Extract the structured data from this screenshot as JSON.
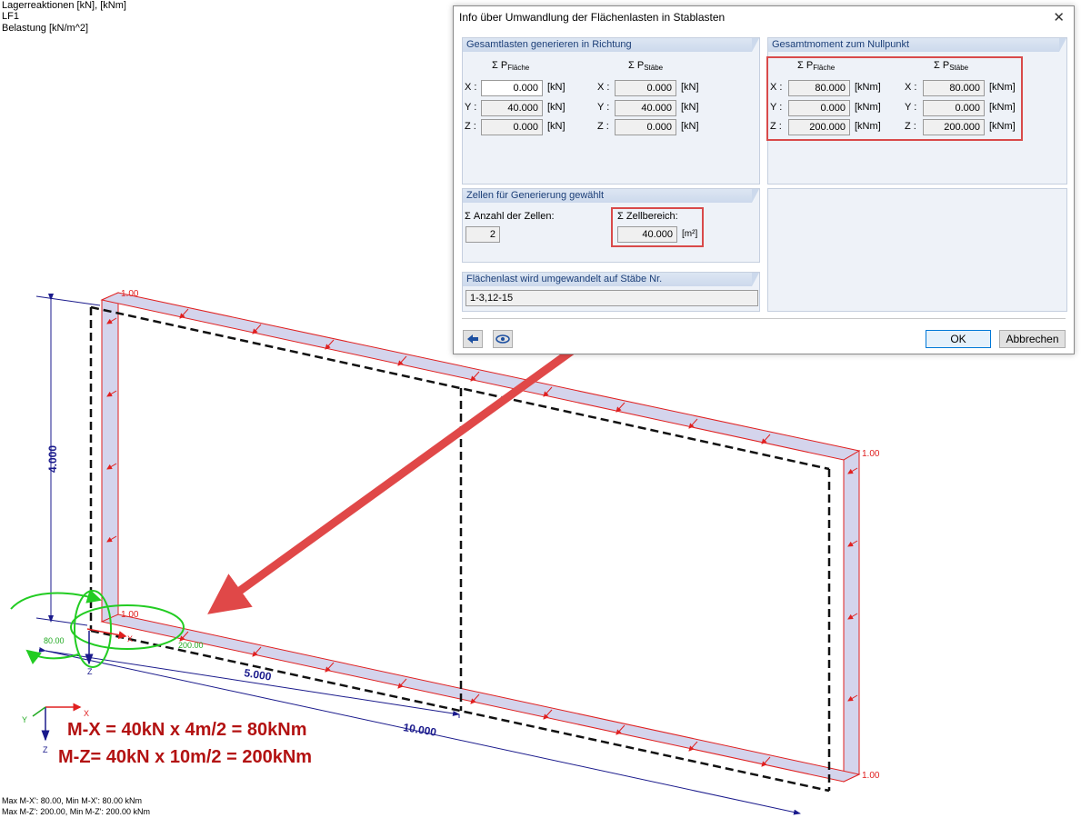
{
  "info": {
    "line1": "Lagerreaktionen [kN], [kNm]",
    "line2": "LF1",
    "line3": "Belastung [kN/m^2]"
  },
  "footer": {
    "line1": "Max M-X': 80.00, Min M-X': 80.00 kNm",
    "line2": "Max M-Z': 200.00, Min M-Z': 200.00 kNm"
  },
  "annotations": {
    "formula1": "M-X = 40kN x 4m/2 = 80kNm",
    "formula2": "M-Z= 40kN x 10m/2 = 200kNm"
  },
  "model": {
    "dim_height": "4.000",
    "dim_half": "5.000",
    "dim_length": "10.000",
    "load_value": "1.00",
    "axis_x": "X",
    "axis_y": "Y",
    "axis_z": "Z",
    "moment_x_value": "80.00",
    "moment_z_value": "200.00",
    "colors": {
      "load": "#e02020",
      "load_fill": "#d4d4ec",
      "dimension": "#1a1a8c",
      "moment": "#22cc22",
      "arrow": "#e04848"
    }
  },
  "dialog": {
    "title": "Info über Umwandlung der Flächenlasten in Stablasten",
    "close_icon": "close-icon",
    "group_loads": {
      "title": "Gesamtlasten generieren in Richtung",
      "col1_sigma": "Σ P",
      "col1_sub": "Fläche",
      "col2_sigma": "Σ P",
      "col2_sub": "Stäbe",
      "rows": [
        {
          "axis": "X :",
          "val1": "0.000",
          "unit1": "[kN]",
          "axis2": "X :",
          "val2": "0.000",
          "unit2": "[kN]"
        },
        {
          "axis": "Y :",
          "val1": "40.000",
          "unit1": "[kN]",
          "axis2": "Y :",
          "val2": "40.000",
          "unit2": "[kN]"
        },
        {
          "axis": "Z :",
          "val1": "0.000",
          "unit1": "[kN]",
          "axis2": "Z :",
          "val2": "0.000",
          "unit2": "[kN]"
        }
      ]
    },
    "group_moments": {
      "title": "Gesamtmoment zum Nullpunkt",
      "col1_sigma": "Σ P",
      "col1_sub": "Fläche",
      "col2_sigma": "Σ P",
      "col2_sub": "Stäbe",
      "rows": [
        {
          "axis": "X :",
          "val1": "80.000",
          "unit1": "[kNm]",
          "axis2": "X :",
          "val2": "80.000",
          "unit2": "[kNm]"
        },
        {
          "axis": "Y :",
          "val1": "0.000",
          "unit1": "[kNm]",
          "axis2": "Y :",
          "val2": "0.000",
          "unit2": "[kNm]"
        },
        {
          "axis": "Z :",
          "val1": "200.000",
          "unit1": "[kNm]",
          "axis2": "Z :",
          "val2": "200.000",
          "unit2": "[kNm]"
        }
      ]
    },
    "group_cells": {
      "title": "Zellen für Generierung gewählt",
      "count_label": "Σ Anzahl der Zellen:",
      "count_value": "2",
      "area_label": "Σ Zellbereich:",
      "area_value": "40.000",
      "area_unit": "[m²]"
    },
    "group_members": {
      "title": "Flächenlast wird umgewandelt auf Stäbe Nr.",
      "value": "1-3,12-15"
    },
    "buttons": {
      "ok": "OK",
      "cancel": "Abbrechen",
      "back_icon": "back-arrow-icon",
      "view_icon": "eye-icon"
    }
  }
}
